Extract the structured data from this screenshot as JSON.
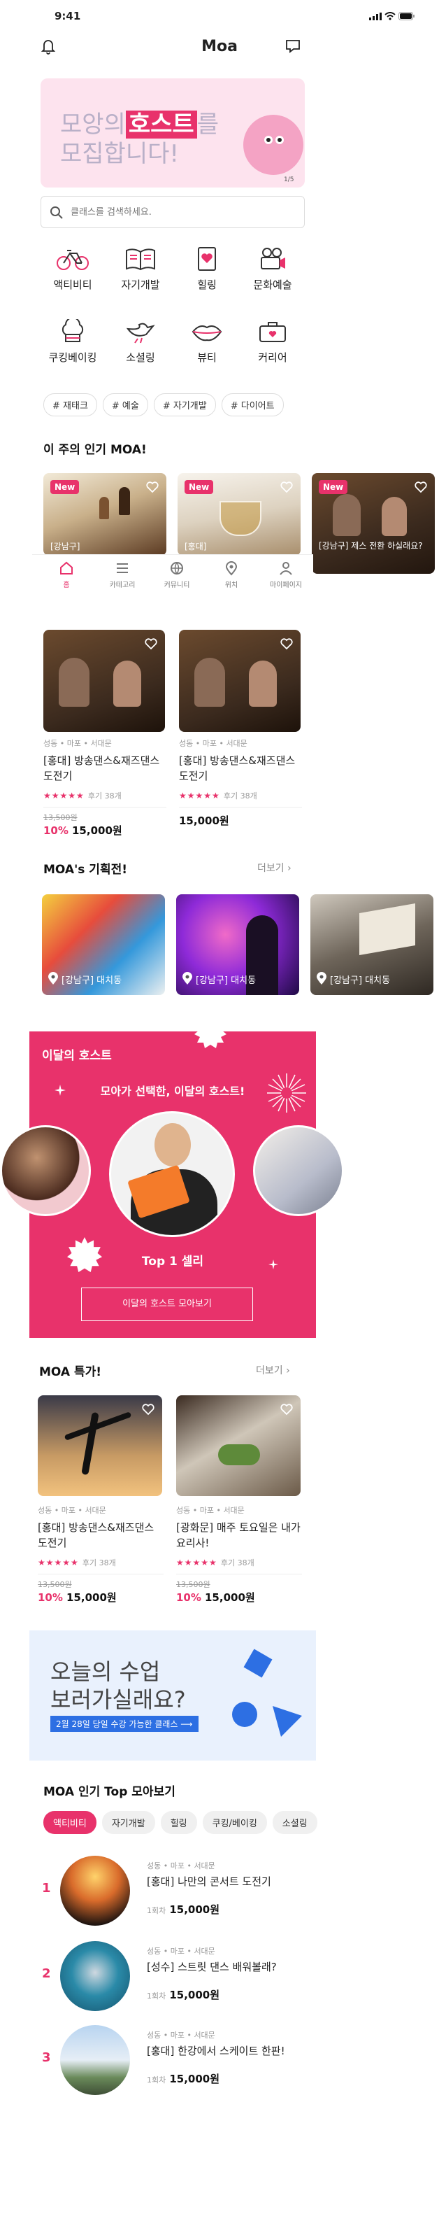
{
  "status": {
    "time": "9:41"
  },
  "header": {
    "title": "Moa"
  },
  "banner": {
    "line1_pre": "모앙의",
    "line1_hl": "호스트",
    "line1_post": "를",
    "line2": "모집합니다!",
    "page": "1/5"
  },
  "search": {
    "placeholder": "클래스를 검색하세요."
  },
  "categories": [
    {
      "label": "액티비티",
      "icon": "bicycle-icon"
    },
    {
      "label": "자기개발",
      "icon": "book-icon"
    },
    {
      "label": "힐링",
      "icon": "heart-note-icon"
    },
    {
      "label": "문화예술",
      "icon": "camera-icon"
    },
    {
      "label": "쿠킹베이킹",
      "icon": "chef-hat-icon"
    },
    {
      "label": "소셜링",
      "icon": "bird-icon"
    },
    {
      "label": "뷰티",
      "icon": "lips-icon"
    },
    {
      "label": "커리어",
      "icon": "briefcase-icon"
    }
  ],
  "hashtags": [
    "# 재태크",
    "# 예술",
    "# 자기개발",
    "# 다이어트"
  ],
  "popular": {
    "title": "이 주의 인기 MOA!",
    "cards": [
      {
        "badge": "New",
        "caption": "[강남구]"
      },
      {
        "badge": "New",
        "caption": "[홍대]"
      },
      {
        "badge": "New",
        "caption": "[강남구] 제스 전환 하실래요?"
      }
    ]
  },
  "bottom_nav": [
    {
      "label": "홈",
      "icon": "home-icon"
    },
    {
      "label": "카테고리",
      "icon": "menu-icon"
    },
    {
      "label": "커뮤니티",
      "icon": "globe-icon"
    },
    {
      "label": "위치",
      "icon": "location-icon"
    },
    {
      "label": "마이페이지",
      "icon": "user-icon"
    }
  ],
  "products": [
    {
      "location": "성동 • 마포 • 서대문",
      "title": "[홍대] 방송댄스&재즈댄스 도전기",
      "stars": "★★★★★",
      "review": "후기 38개",
      "orig": "13,500원",
      "discount": "10%",
      "price": "15,000원"
    },
    {
      "location": "성동 • 마포 • 서대문",
      "title": "[홍대] 방송댄스&재즈댄스 도전기",
      "stars": "★★★★★",
      "review": "후기 38개",
      "price": "15,000원"
    }
  ],
  "planned": {
    "title": "MOA's 기획전!",
    "more": "더보기",
    "cards": [
      {
        "caption": "[강남구] 대치동"
      },
      {
        "caption": "[강남구] 대치동"
      },
      {
        "caption": "[강남구] 대치동"
      }
    ]
  },
  "host": {
    "title": "이달의 호스트",
    "subtitle": "모아가 선택한, 이달의 호스트!",
    "name": "Top 1 셀리",
    "button": "이달의 호스트 모아보기"
  },
  "special": {
    "title": "MOA 특가!",
    "more": "더보기",
    "items": [
      {
        "location": "성동 • 마포 • 서대문",
        "title": "[홍대] 방송댄스&재즈댄스 도전기",
        "stars": "★★★★★",
        "review": "후기 38개",
        "orig": "13,500원",
        "discount": "10%",
        "price": "15,000원"
      },
      {
        "location": "성동 • 마포 • 서대문",
        "title": "[광화문] 매주 토요일은 내가 요리사!",
        "stars": "★★★★★",
        "review": "후기 38개",
        "orig": "13,500원",
        "discount": "10%",
        "price": "15,000원"
      }
    ]
  },
  "today": {
    "line1": "오늘의 수업",
    "line2": "보러가실래요?",
    "sub": "2월 28일 당일 수강 가능한 클래스"
  },
  "top": {
    "title": "MOA 인기 Top 모아보기",
    "tabs": [
      "액티비티",
      "자기개발",
      "힐링",
      "쿠킹/베이킹",
      "소셜링"
    ],
    "items": [
      {
        "rank": "1",
        "location": "성동 • 마포 • 서대문",
        "title": "[홍대] 나만의 콘서트 도전기",
        "unit": "1회차",
        "price": "15,000원"
      },
      {
        "rank": "2",
        "location": "성동 • 마포 • 서대문",
        "title": "[성수] 스트릿 댄스 배워볼래?",
        "unit": "1회차",
        "price": "15,000원"
      },
      {
        "rank": "3",
        "location": "성동 • 마포 • 서대문",
        "title": "[홍대] 한강에서 스케이트 한판!",
        "unit": "1회차",
        "price": "15,000원"
      }
    ]
  },
  "colors": {
    "accent": "#e8326b",
    "banner_bg": "#fde3ee",
    "today_bg": "#e9f1fd",
    "blue": "#2d6fe3"
  }
}
